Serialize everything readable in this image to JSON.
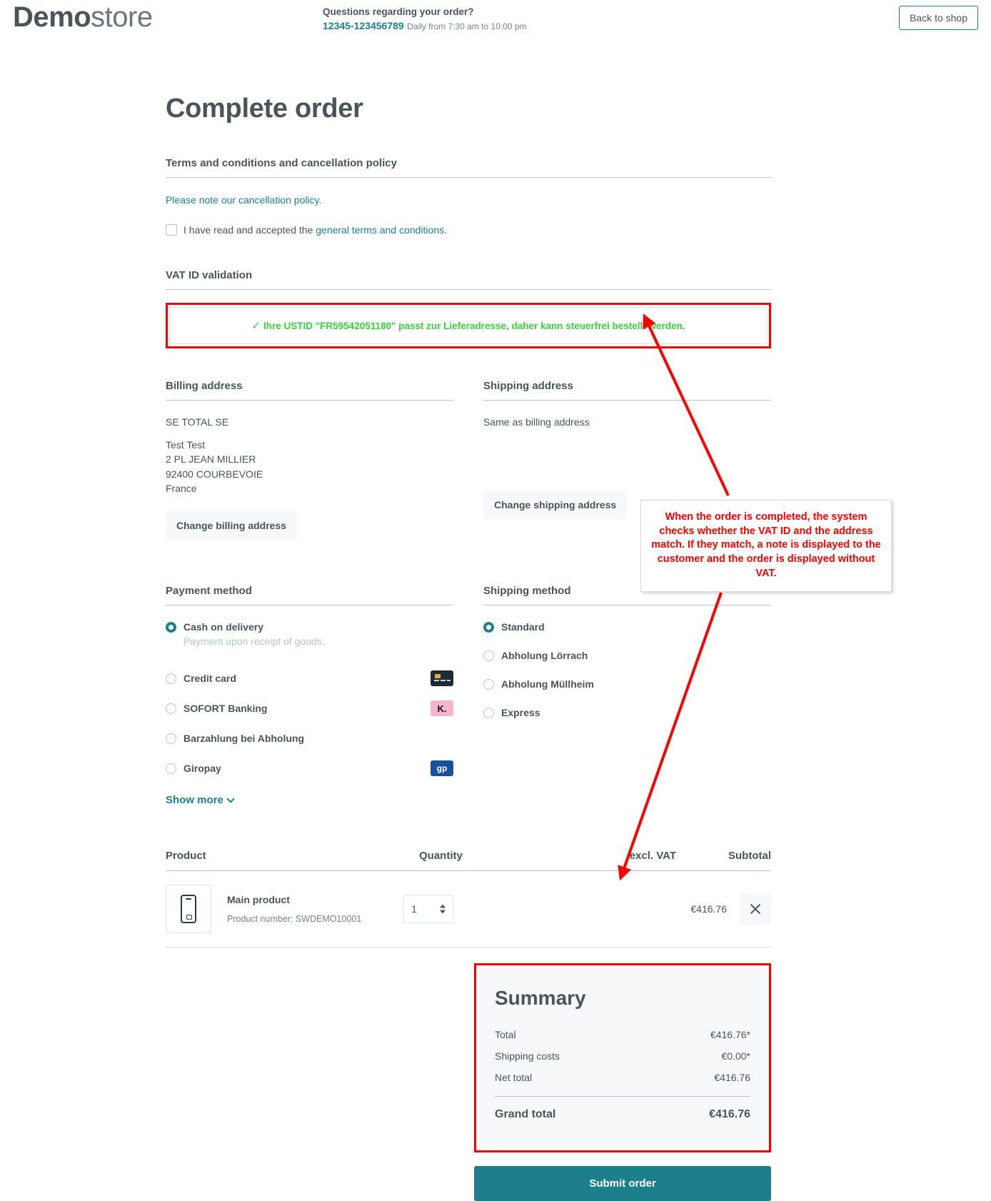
{
  "header": {
    "logo_bold": "Demo",
    "logo_light": "store",
    "contact_question": "Questions regarding your order?",
    "contact_phone": "12345-123456789",
    "contact_hours": "Daily from 7:30 am to 10:00 pm",
    "back_to_shop": "Back to shop"
  },
  "page": {
    "title": "Complete order"
  },
  "terms": {
    "heading": "Terms and conditions and cancellation policy",
    "cancellation_link": "Please note our cancellation policy.",
    "accept_prefix": "I have read and accepted the ",
    "accept_link": "general terms and conditions",
    "accept_suffix": "."
  },
  "vat": {
    "heading": "VAT ID validation",
    "check_icon": "✓",
    "message": "Ihre USTID \"FR59542051180\" passt zur Lieferadresse, daher kann steuerfrei bestellt werden.",
    "message_color": "#3ecf3e",
    "highlight_color": "#f80000"
  },
  "billing": {
    "heading": "Billing address",
    "company": "SE TOTAL SE",
    "lines": [
      "Test Test",
      "2 PL JEAN MILLIER",
      "92400 COURBEVOIE",
      "France"
    ],
    "change_button": "Change billing address"
  },
  "shipping": {
    "heading": "Shipping address",
    "same_as": "Same as billing address",
    "change_button": "Change shipping address"
  },
  "payment": {
    "heading": "Payment method",
    "options": [
      {
        "label": "Cash on delivery",
        "sub": "Payment upon receipt of goods.",
        "selected": true,
        "icon": ""
      },
      {
        "label": "Credit card",
        "sub": "",
        "selected": false,
        "icon": "credit-card-icon"
      },
      {
        "label": "SOFORT Banking",
        "sub": "",
        "selected": false,
        "icon": "klarna-icon",
        "icon_text": "K."
      },
      {
        "label": "Barzahlung bei Abholung",
        "sub": "",
        "selected": false,
        "icon": ""
      },
      {
        "label": "Giropay",
        "sub": "",
        "selected": false,
        "icon": "giropay-icon",
        "icon_text": "gp"
      }
    ],
    "show_more": "Show more"
  },
  "shipping_method": {
    "heading": "Shipping method",
    "options": [
      {
        "label": "Standard",
        "selected": true
      },
      {
        "label": "Abholung Lörrach",
        "selected": false
      },
      {
        "label": "Abholung Müllheim",
        "selected": false
      },
      {
        "label": "Express",
        "selected": false
      }
    ]
  },
  "cart": {
    "columns": [
      "Product",
      "Quantity",
      "excl. VAT",
      "Subtotal"
    ],
    "rows": [
      {
        "name": "Main product",
        "product_number": "Product number: SWDEMO10001",
        "quantity": "1",
        "excl_vat": "",
        "subtotal": "€416.76"
      }
    ]
  },
  "summary": {
    "title": "Summary",
    "rows": [
      {
        "label": "Total",
        "value": "€416.76*"
      },
      {
        "label": "Shipping costs",
        "value": "€0.00*"
      },
      {
        "label": "Net total",
        "value": "€416.76"
      }
    ],
    "grand_label": "Grand total",
    "grand_value": "€416.76",
    "submit_label": "Submit order"
  },
  "annotation": {
    "text": "When the order is completed, the system checks whether the VAT ID and the address match. If they match, a note is displayed to the customer and the order is displayed without VAT.",
    "color": "#ff0000"
  },
  "colors": {
    "accent": "#1d7f8c",
    "text": "#4a545b",
    "muted": "#798186",
    "panel": "#f7f8f9",
    "border": "#dfe3e8"
  }
}
